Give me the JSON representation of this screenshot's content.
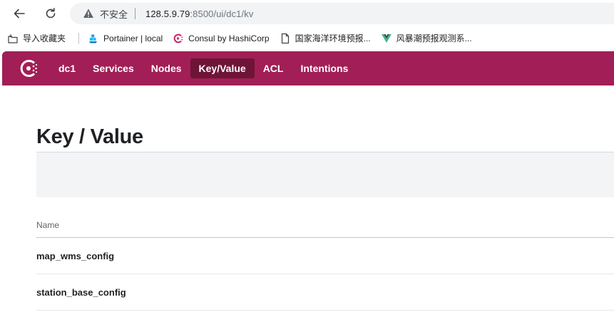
{
  "browser": {
    "security_label": "不安全",
    "url_host": "128.5.9.79",
    "url_path": ":8500/ui/dc1/kv",
    "bookmarks": [
      {
        "label": "导入收藏夹",
        "icon": "import-bookmarks-icon"
      },
      {
        "label": "Portainer | local",
        "icon": "portainer-icon"
      },
      {
        "label": "Consul by HashiCorp",
        "icon": "consul-icon"
      },
      {
        "label": "国家海洋环境预报...",
        "icon": "document-icon"
      },
      {
        "label": "风暴潮预报观测系...",
        "icon": "vue-logo-icon"
      }
    ]
  },
  "nav": {
    "datacenter": "dc1",
    "items": [
      {
        "label": "Services"
      },
      {
        "label": "Nodes"
      },
      {
        "label": "Key/Value",
        "active": true
      },
      {
        "label": "ACL"
      },
      {
        "label": "Intentions"
      }
    ],
    "brand_color": "#a11f56",
    "active_color": "#6e1537"
  },
  "page": {
    "title": "Key / Value",
    "column_name": "Name",
    "rows": [
      {
        "name": "map_wms_config"
      },
      {
        "name": "station_base_config"
      }
    ]
  }
}
